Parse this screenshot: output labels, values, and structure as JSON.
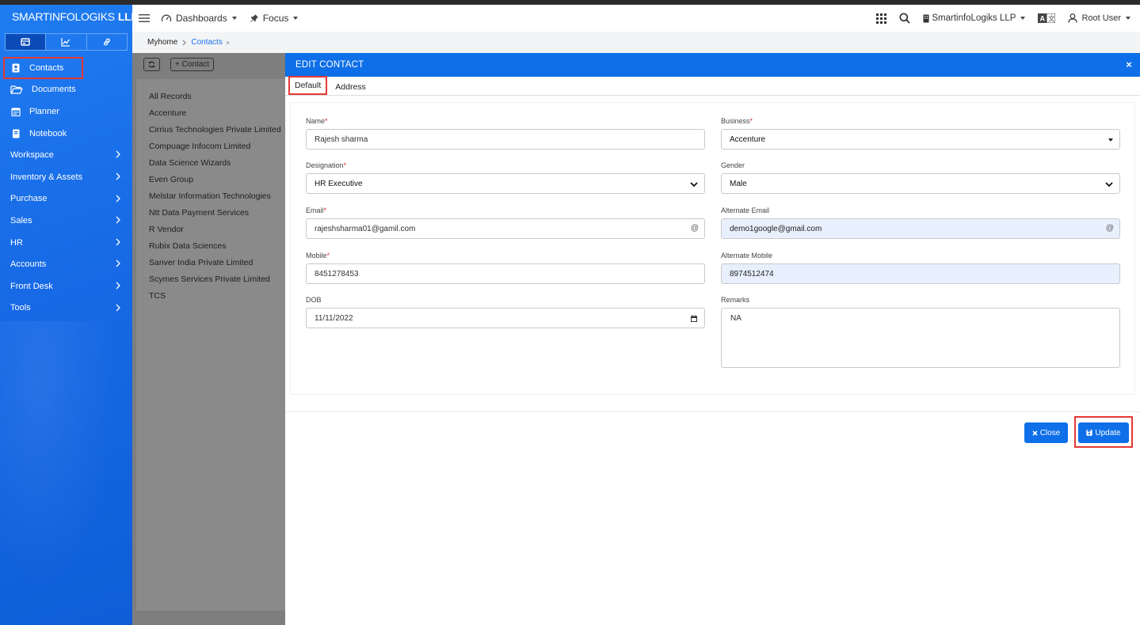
{
  "brand": {
    "name": "SMARTINFOLOGIKS",
    "suffix": "LLP"
  },
  "header": {
    "dashboards": "Dashboards",
    "focus": "Focus",
    "company": "SmartinfoLogiks LLP",
    "user": "Root User",
    "lang_icon": "translate-icon"
  },
  "sidebar": {
    "items": [
      {
        "label": "Contacts",
        "icon": "contact-card-icon"
      },
      {
        "label": "Documents",
        "icon": "folder-open-icon"
      },
      {
        "label": "Planner",
        "icon": "calendar-icon"
      },
      {
        "label": "Notebook",
        "icon": "notebook-icon"
      },
      {
        "label": "Workspace"
      },
      {
        "label": "Inventory & Assets"
      },
      {
        "label": "Purchase"
      },
      {
        "label": "Sales"
      },
      {
        "label": "HR"
      },
      {
        "label": "Accounts"
      },
      {
        "label": "Front Desk"
      },
      {
        "label": "Tools"
      }
    ]
  },
  "breadcrumb": {
    "home": "Myhome",
    "current": "Contacts",
    "close": "×"
  },
  "list_panel": {
    "add_button": "+ Contact",
    "items": [
      "All Records",
      "Accenture",
      "Cirrius Technologies Private Limited",
      "Compuage Infocom Limited",
      "Data Science Wizards",
      "Even Group",
      "Melstar Information Technologies",
      "Ntt Data Payment Services",
      "R Vendor",
      "Rubix Data Sciences",
      "Sanver India Private Limited",
      "Scymes Services Private Limited",
      "TCS"
    ]
  },
  "modal": {
    "title": "EDIT CONTACT",
    "close": "×",
    "tabs": [
      "Default",
      "Address"
    ],
    "fields": {
      "name": {
        "label": "Name",
        "required": "*",
        "value": "Rajesh sharma"
      },
      "business": {
        "label": "Business",
        "required": "*",
        "value": "Accenture"
      },
      "designation": {
        "label": "Designation",
        "required": "*",
        "value": "HR Executive"
      },
      "gender": {
        "label": "Gender",
        "value": "Male"
      },
      "email": {
        "label": "Email",
        "required": "*",
        "value": "rajeshsharma01@gamil.com",
        "suffix": "@"
      },
      "alt_email": {
        "label": "Alternate Email",
        "value": "demo1google@gmail.com",
        "suffix": "@"
      },
      "mobile": {
        "label": "Mobile",
        "required": "*",
        "value": "8451278453"
      },
      "alt_mobile": {
        "label": "Alternate Mobile",
        "value": "8974512474"
      },
      "dob": {
        "label": "DOB",
        "value": "11/11/2022"
      },
      "remarks": {
        "label": "Remarks",
        "value": "NA"
      }
    },
    "buttons": {
      "close": "Close",
      "update": "Update"
    }
  },
  "colors": {
    "primary": "#0e6fe8",
    "highlight": "#e53935",
    "sidebar": "#1769e6"
  }
}
